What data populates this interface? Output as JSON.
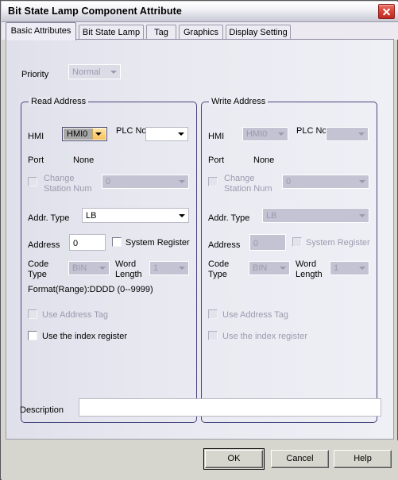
{
  "window": {
    "title": "Bit State Lamp Component Attribute",
    "close_icon": "close-x-icon"
  },
  "tabs": [
    {
      "label": "Basic Attributes",
      "active": true
    },
    {
      "label": "Bit State Lamp",
      "active": false
    },
    {
      "label": "Tag",
      "active": false
    },
    {
      "label": "Graphics",
      "active": false
    },
    {
      "label": "Display Setting",
      "active": false
    }
  ],
  "priority": {
    "label": "Priority",
    "value": "Normal",
    "enabled": false
  },
  "read_address": {
    "title": "Read Address",
    "hmi_label": "HMI",
    "hmi_value": "HMI0",
    "plc_label": "PLC No.",
    "plc_value": "",
    "port_label": "Port",
    "port_value": "None",
    "change_station_label_line1": "Change",
    "change_station_label_line2": "Station Num",
    "change_station_value": "0",
    "addr_type_label": "Addr. Type",
    "addr_type_value": "LB",
    "address_label": "Address",
    "address_value": "0",
    "system_register_label": "System Register",
    "code_type_label_line1": "Code",
    "code_type_label_line2": "Type",
    "code_type_value": "BIN",
    "word_length_label_line1": "Word",
    "word_length_label_line2": "Length",
    "word_length_value": "1",
    "format_text": "Format(Range):DDDD (0--9999)",
    "use_address_tag_label": "Use Address Tag",
    "use_index_register_label": "Use the index register"
  },
  "write_address": {
    "title": "Write Address",
    "hmi_label": "HMI",
    "hmi_value": "HMI0",
    "plc_label": "PLC No.",
    "plc_value": "",
    "port_label": "Port",
    "port_value": "None",
    "change_station_label_line1": "Change",
    "change_station_label_line2": "Station Num",
    "change_station_value": "0",
    "addr_type_label": "Addr. Type",
    "addr_type_value": "LB",
    "address_label": "Address",
    "address_value": "0",
    "system_register_label": "System Register",
    "code_type_label_line1": "Code",
    "code_type_label_line2": "Type",
    "code_type_value": "BIN",
    "word_length_label_line1": "Word",
    "word_length_label_line2": "Length",
    "word_length_value": "1",
    "use_address_tag_label": "Use Address Tag",
    "use_index_register_label": "Use the index register"
  },
  "description": {
    "label": "Description",
    "value": ""
  },
  "buttons": {
    "ok": "OK",
    "cancel": "Cancel",
    "help": "Help"
  },
  "colors": {
    "accent_orange": "#fdd27a",
    "group_border": "#46467e",
    "close_red": "#d9453c",
    "panel_bg": "#e9eaf1",
    "disabled_text": "#9a9aae"
  }
}
